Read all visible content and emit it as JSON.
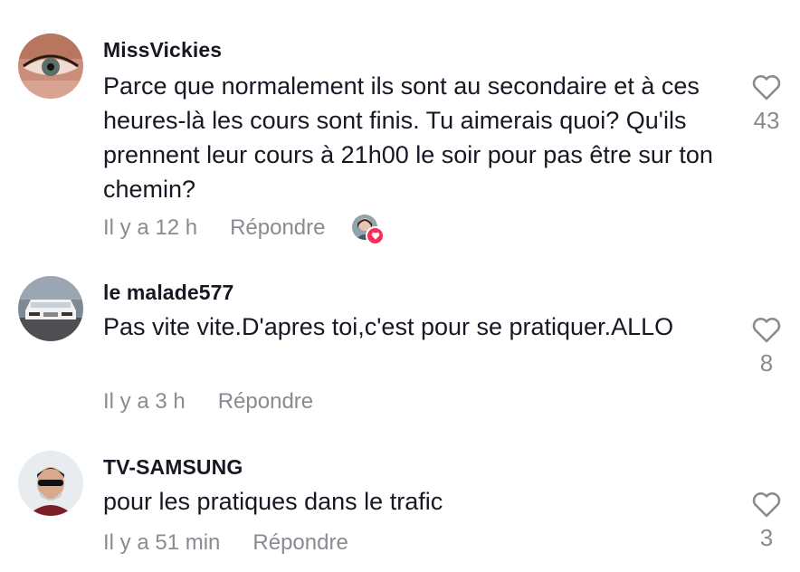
{
  "comments": [
    {
      "username": "MissVickies",
      "text": "Parce que normalement ils sont au secondaire et à ces heures-là les cours sont finis. Tu aimerais quoi? Qu'ils prennent leur cours à 21h00 le soir pour pas être sur ton chemin?",
      "time": "Il y a 12 h",
      "reply_label": "Répondre",
      "likes": "43",
      "creator_liked": true
    },
    {
      "username": "le malade577",
      "text": "Pas vite vite.D'apres toi,c'est pour se pratiquer.ALLO",
      "time": "Il y a 3 h",
      "reply_label": "Répondre",
      "likes": "8",
      "creator_liked": false
    },
    {
      "username": "TV-SAMSUNG",
      "text": "pour les pratiques dans le trafic",
      "time": "Il y a 51 min",
      "reply_label": "Répondre",
      "likes": "3",
      "creator_liked": false
    }
  ],
  "colors": {
    "text": "#161823",
    "muted": "#8a8b91",
    "heart_badge": "#fe2c55"
  },
  "icons": {
    "like": "heart-outline-icon",
    "creator_like_badge": "heart-badge-icon"
  }
}
